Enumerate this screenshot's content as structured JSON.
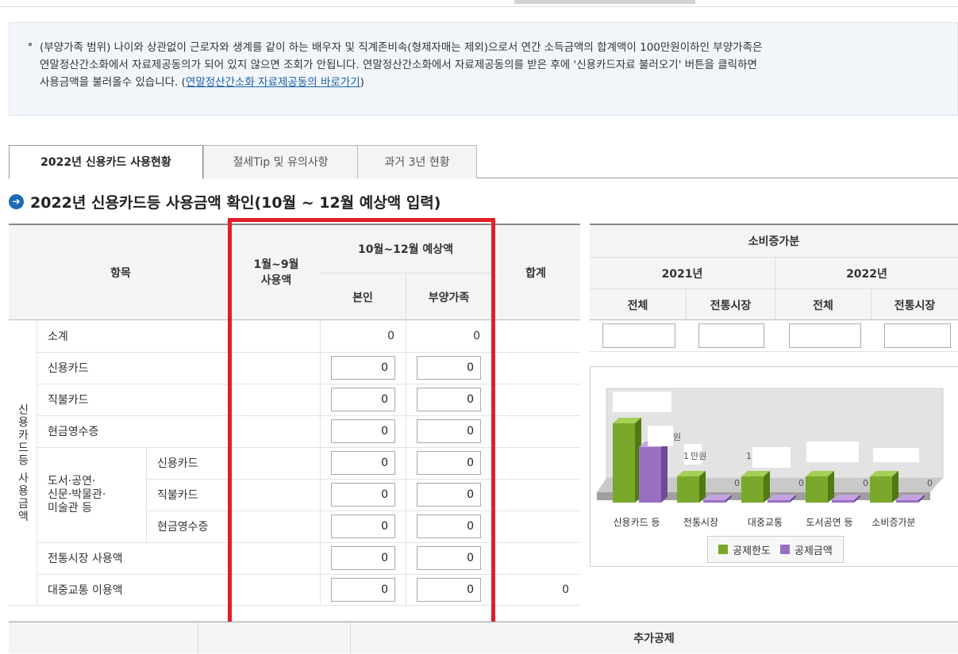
{
  "notice": {
    "line1": "(부양가족 범위) 나이와 상관없이 근로자와 생계를 같이 하는 배우자 및 직계존비속(형제자매는 제외)으로서 연간 소득금액의 합계액이 100만원이하인 부양가족은",
    "line2": "연말정산간소화에서 자료제공동의가 되어 있지 않으면 조회가 안됩니다. 연말정산간소화에서 자료제공동의를 받은 후에 '신용카드자료 불러오기' 버튼을 클릭하면",
    "line3_pre": "사용금액을 불러올수 있습니다. (",
    "link": "연말정산간소화 자료제공동의 바로가기",
    "line3_post": ")"
  },
  "tabs": [
    "2022년 신용카드 사용현황",
    "절세Tip 및 유의사항",
    "과거 3년 현황"
  ],
  "section_title": "2022년 신용카드등 사용금액 확인(10월 ~ 12월 예상액 입력)",
  "table": {
    "h_item": "항목",
    "h_jan_sep": "1월~9월\n사용액",
    "h_oct_dec": "10월~12월 예상액",
    "h_self": "본인",
    "h_dependent": "부양가족",
    "h_total": "합계",
    "group_label": "신용카드등 사용금액",
    "sub_group_label": "도서·공연·\n신문·박물관·\n미술관 등",
    "rows": [
      {
        "label": "소계",
        "self": "0",
        "dep": "0",
        "total": ""
      },
      {
        "label": "신용카드",
        "self": "0",
        "dep": "0",
        "total": ""
      },
      {
        "label": "직불카드",
        "self": "0",
        "dep": "0",
        "total": ""
      },
      {
        "label": "현금영수증",
        "self": "0",
        "dep": "0",
        "total": ""
      },
      {
        "label": "신용카드",
        "self": "0",
        "dep": "0",
        "total": ""
      },
      {
        "label": "직불카드",
        "self": "0",
        "dep": "0",
        "total": ""
      },
      {
        "label": "현금영수증",
        "self": "0",
        "dep": "0",
        "total": ""
      },
      {
        "label": "전통시장 사용액",
        "self": "0",
        "dep": "0",
        "total": ""
      },
      {
        "label": "대중교통 이용액",
        "self": "0",
        "dep": "0",
        "total": "0"
      }
    ]
  },
  "consumption": {
    "title": "소비증가분",
    "y2021": "2021년",
    "y2022": "2022년",
    "all": "전체",
    "market": "전통시장"
  },
  "chart_data": {
    "type": "bar",
    "categories": [
      "신용카드 등",
      "전통시장",
      "대중교통",
      "도서공연 등",
      "소비증가분"
    ],
    "series": [
      {
        "name": "공제한도",
        "color": "#7aa82a",
        "values": [
          100,
          33,
          33,
          33,
          33
        ]
      },
      {
        "name": "공제금액",
        "color": "#9a6fc2",
        "values": [
          70,
          0,
          0,
          0,
          0
        ]
      }
    ],
    "labels": [
      "",
      "0",
      "0",
      "0",
      "0"
    ],
    "partial_labels": [
      "원",
      "1",
      "만원",
      "1"
    ]
  },
  "additional": "추가공제"
}
